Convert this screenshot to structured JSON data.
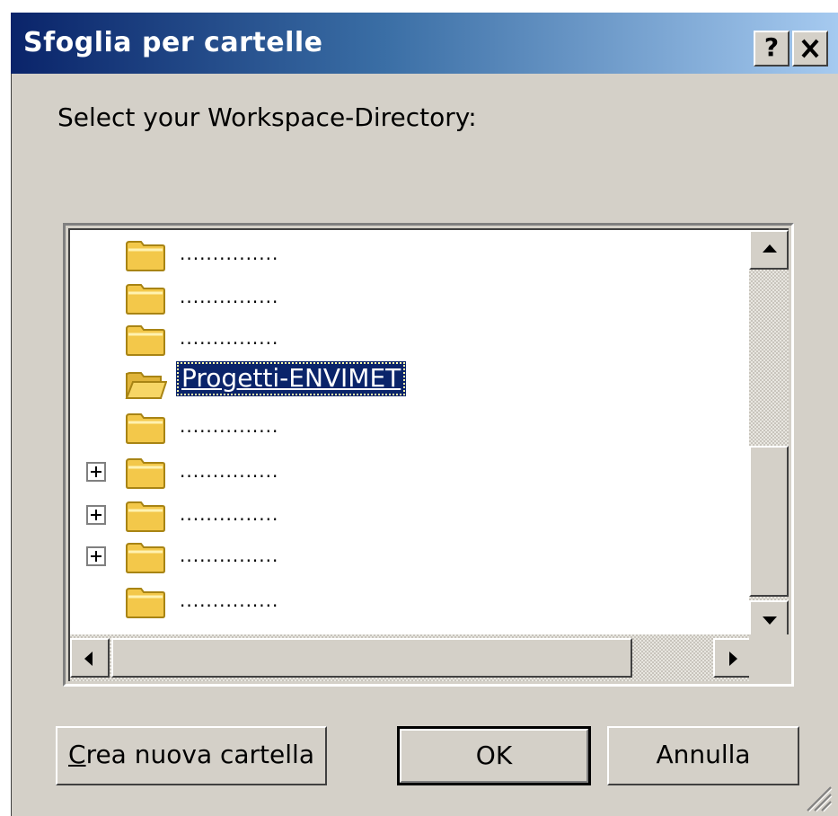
{
  "dialog": {
    "title": "Sfoglia per cartelle",
    "help_button": "?",
    "close_button": "X",
    "prompt": "Select your Workspace-Directory:"
  },
  "tree": {
    "items": [
      {
        "label": "...............",
        "expandable": false,
        "selected": false
      },
      {
        "label": "...............",
        "expandable": false,
        "selected": false
      },
      {
        "label": "...............",
        "expandable": false,
        "selected": false
      },
      {
        "label": "Progetti-ENVIMET",
        "expandable": false,
        "selected": true
      },
      {
        "label": "...............",
        "expandable": false,
        "selected": false
      },
      {
        "label": "...............",
        "expandable": true,
        "selected": false
      },
      {
        "label": "...............",
        "expandable": true,
        "selected": false
      },
      {
        "label": "...............",
        "expandable": true,
        "selected": false
      },
      {
        "label": "...............",
        "expandable": false,
        "selected": false
      }
    ],
    "icons": {
      "folder": "folder-icon",
      "expand": "plus-expand-icon"
    }
  },
  "buttons": {
    "new_folder_accel": "C",
    "new_folder_rest": "rea nuova cartella",
    "ok": "OK",
    "cancel": "Annulla"
  },
  "colors": {
    "selection": "#0a246a",
    "title_start": "#0a246a",
    "title_end": "#a6caf0",
    "face": "#d4d0c8",
    "folder": "#f3c84a"
  }
}
